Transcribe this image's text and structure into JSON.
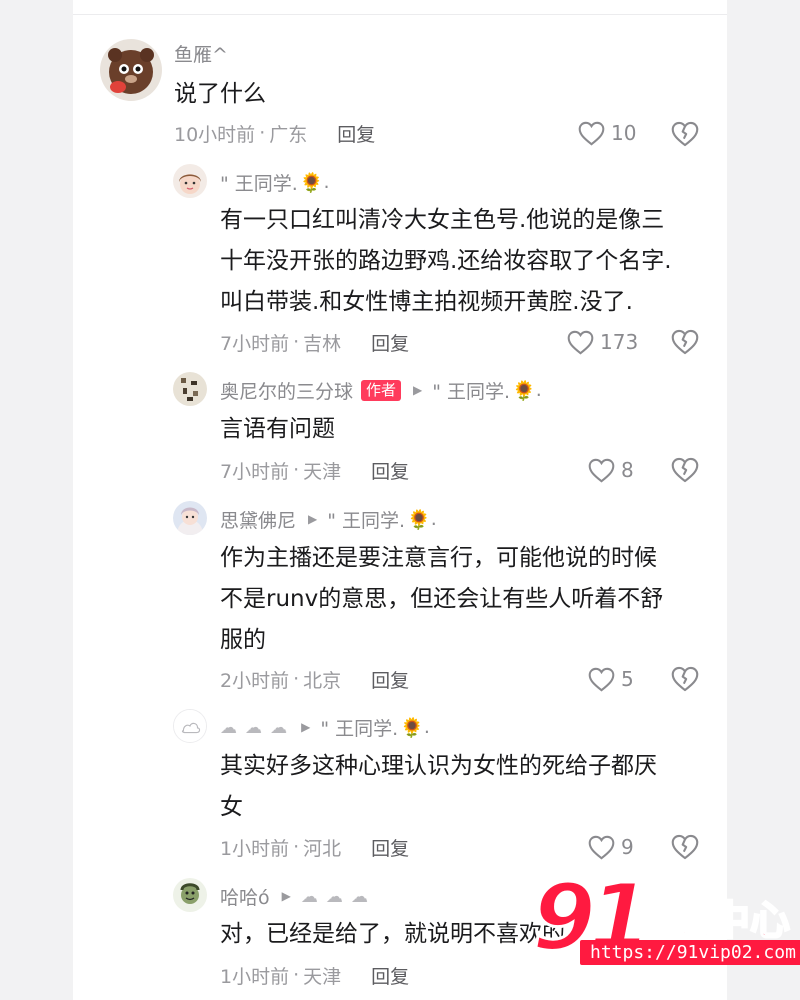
{
  "comments": [
    {
      "username": "鱼雁^",
      "text": "说了什么",
      "time": "10小时前",
      "location": "广东",
      "reply_label": "回复",
      "likes": "10"
    },
    {
      "username": "\" 王同学.",
      "sun": "🌻",
      "dot": ".",
      "text_lines": [
        "有一只口红叫清冷大女主色号.他说的是像三",
        "十年没开张的路边野鸡.还给妆容取了个名字.",
        "叫白带装.和女性博主拍视频开黄腔.没了."
      ],
      "time": "7小时前",
      "location": "吉林",
      "reply_label": "回复",
      "likes": "173"
    },
    {
      "username": "奥尼尔的三分球",
      "author_tag": "作者",
      "reply_to": "\" 王同学.",
      "sun": "🌻",
      "dot": ".",
      "text": "言语有问题",
      "time": "7小时前",
      "location": "天津",
      "reply_label": "回复",
      "likes": "8"
    },
    {
      "username": "思黛佛尼",
      "reply_to": "\" 王同学.",
      "sun": "🌻",
      "dot": ".",
      "text_lines": [
        "作为主播还是要注意言行，可能他说的时候",
        "不是runv的意思，但还会让有些人听着不舒",
        "服的"
      ],
      "time": "2小时前",
      "location": "北京",
      "reply_label": "回复",
      "likes": "5"
    },
    {
      "username_clouds": [
        "☁",
        "☁",
        "☁"
      ],
      "reply_to": "\" 王同学.",
      "sun": "🌻",
      "dot": ".",
      "text_lines": [
        "其实好多这种心理认识为女性的死给子都厌",
        "女"
      ],
      "time": "1小时前",
      "location": "河北",
      "reply_label": "回复",
      "likes": "9"
    },
    {
      "username": "哈哈ó",
      "reply_clouds": [
        "☁",
        "☁",
        "☁"
      ],
      "text": "对，已经是给了，就说明不喜欢的",
      "time": "1小时前",
      "location": "天津",
      "reply_label": "回复"
    }
  ],
  "meta_separator": "·",
  "watermark": {
    "number": "91",
    "text": "吃瓜中心",
    "url": "https://91vip02.com"
  },
  "colors": {
    "accent": "#ff3b5c",
    "watermark": "#ff1a40"
  }
}
